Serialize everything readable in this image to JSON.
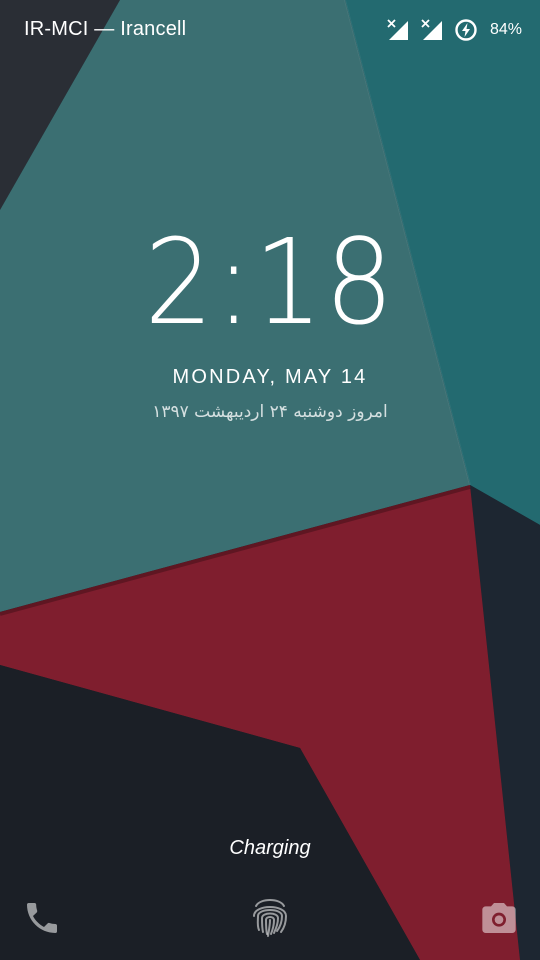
{
  "status_bar": {
    "carrier": "IR-MCI — Irancell",
    "icons": [
      "signal-no-data-icon",
      "signal-no-data-icon",
      "battery-charging-icon"
    ],
    "battery_percent": "84%"
  },
  "lockscreen": {
    "time": "2:18",
    "date": "MONDAY, MAY 14",
    "persian_date": "امروز دوشنبه ۲۴ اردیبهشت ۱۳۹۷",
    "charging_status": "Charging"
  },
  "shortcuts": {
    "left": "phone-icon",
    "center": "fingerprint-icon",
    "right": "camera-icon"
  },
  "colors": {
    "teal": "#3b6f72",
    "dark_teal": "#236a70",
    "crimson": "#7f1e2e",
    "charcoal": "#1b1f26",
    "dark_navy": "#1d2631"
  }
}
